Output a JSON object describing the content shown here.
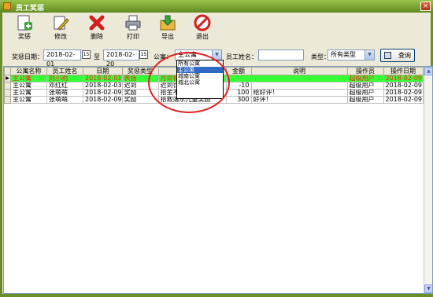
{
  "window": {
    "title": "员工奖惩"
  },
  "toolbar": {
    "add_label": "奖惩",
    "edit_label": "修改",
    "delete_label": "删除",
    "print_label": "打印",
    "export_label": "导出",
    "exit_label": "退出"
  },
  "filter": {
    "date_label": "奖惩日期：",
    "date_from": "2018-02-01",
    "to_label": "至",
    "date_to": "2018-02-20",
    "apartment_label": "公寓：",
    "apartment_value": "主公寓",
    "apartment_options": [
      "所有公寓",
      "主公寓",
      "城南公寓",
      "城北公寓"
    ],
    "employee_label": "员工姓名：",
    "employee_value": "",
    "type_label": "类型：",
    "type_value": "所有类型",
    "query_label": "查询"
  },
  "grid": {
    "columns": [
      "公寓名称",
      "员工姓名",
      "日期",
      "奖惩类型",
      "奖惩原因",
      "金额",
      "说明",
      "操作员",
      "操作日期"
    ],
    "rows": [
      {
        "apartment": "主公寓",
        "employee": "刘小明",
        "date": "2018-02-01",
        "type": "表扬",
        "reason": "月目标达成",
        "amount": "",
        "note": "",
        "operator": "超级用户",
        "op_date": "2018-02-09"
      },
      {
        "apartment": "主公寓",
        "employee": "邓红红",
        "date": "2018-02-03",
        "type": "迟到",
        "reason": "迟到罚款10元",
        "amount": "-10",
        "note": "",
        "operator": "超级用户",
        "op_date": "2018-02-09"
      },
      {
        "apartment": "主公寓",
        "employee": "张萌萌",
        "date": "2018-02-09",
        "type": "奖励",
        "reason": "拾金不昧奖励100元",
        "amount": "100",
        "note": "给好评！",
        "operator": "超级用户",
        "op_date": "2018-02-09"
      },
      {
        "apartment": "主公寓",
        "employee": "张萌萌",
        "date": "2018-02-09",
        "type": "奖励",
        "reason": "拾救落水儿童奖励",
        "amount": "300",
        "note": "好评！",
        "operator": "超级用户",
        "op_date": "2018-02-09"
      }
    ]
  }
}
